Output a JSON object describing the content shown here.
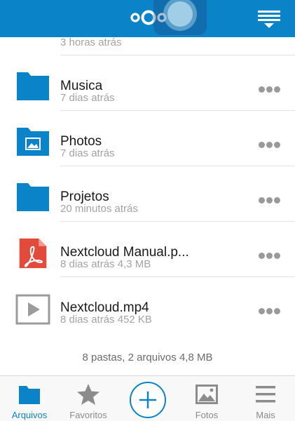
{
  "header": {
    "logo_icon": "nextcloud-logo-icon",
    "menu_icon": "sort-menu-icon",
    "brand_color": "#0b83c9"
  },
  "files": [
    {
      "name": "",
      "meta": "3 horas atrás",
      "icon": "folder-icon"
    },
    {
      "name": "Musica",
      "meta": "7 dias atrás",
      "icon": "folder-icon"
    },
    {
      "name": "Photos",
      "meta": "7 dias atrás",
      "icon": "photo-folder-icon"
    },
    {
      "name": "Projetos",
      "meta": "20 minutos atrás",
      "icon": "folder-icon"
    },
    {
      "name": "Nextcloud Manual.p...",
      "meta": "8 dias atrás 4,3 MB",
      "icon": "pdf-file-icon"
    },
    {
      "name": "Nextcloud.mp4",
      "meta": "8 dias atrás 452 KB",
      "icon": "video-file-icon"
    }
  ],
  "summary": "8 pastas, 2 arquivos 4,8 MB",
  "tabbar": {
    "arquivos": "Arquivos",
    "favoritos": "Favoritos",
    "fotos": "Fotos",
    "mais": "Mais"
  }
}
